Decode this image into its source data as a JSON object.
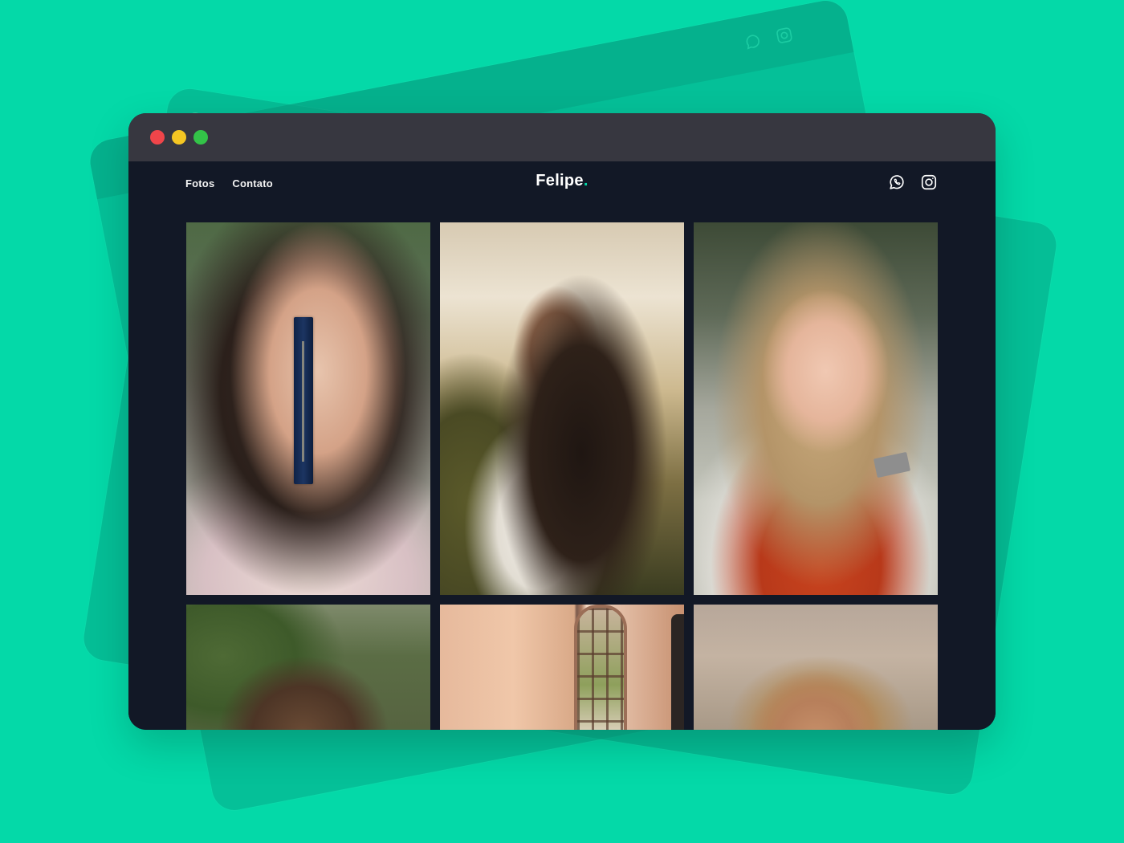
{
  "background": {
    "color": "#04D9A8"
  },
  "browser": {
    "traffic_lights": [
      "#F0454A",
      "#F5C623",
      "#33C348"
    ]
  },
  "site": {
    "brand": "Felipe",
    "brand_suffix": ".",
    "accent_color": "#04D9A8",
    "nav": [
      {
        "label": "Fotos"
      },
      {
        "label": "Contato"
      }
    ],
    "social_icons": [
      "whatsapp-icon",
      "instagram-icon"
    ]
  },
  "gallery": {
    "photos": [
      {
        "name": "photo-woman-book"
      },
      {
        "name": "photo-couple-sunset"
      },
      {
        "name": "photo-woman-orange-vest"
      },
      {
        "name": "photo-woman-blurred"
      },
      {
        "name": "photo-room-window"
      },
      {
        "name": "photo-woman-curly-hair"
      }
    ]
  }
}
